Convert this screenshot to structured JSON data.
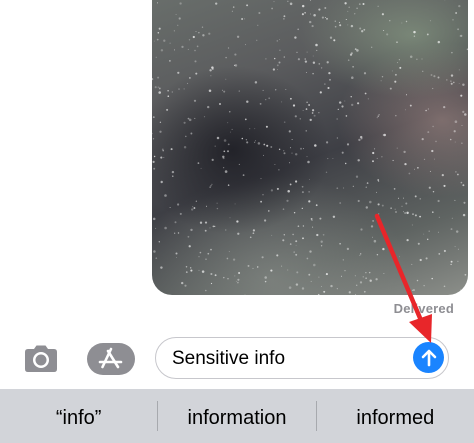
{
  "message": {
    "status": "Delivered"
  },
  "composer": {
    "text": "Sensitive info"
  },
  "suggestions": [
    "“info”",
    "information",
    "informed"
  ],
  "icons": {
    "camera": "camera-icon",
    "apps": "app-store-icon",
    "send": "send-arrow-icon"
  },
  "colors": {
    "send_button": "#1a84ff",
    "annotation_arrow": "#e8262a",
    "status_text": "#8e8e93",
    "suggestion_bar": "#d2d4d9"
  }
}
